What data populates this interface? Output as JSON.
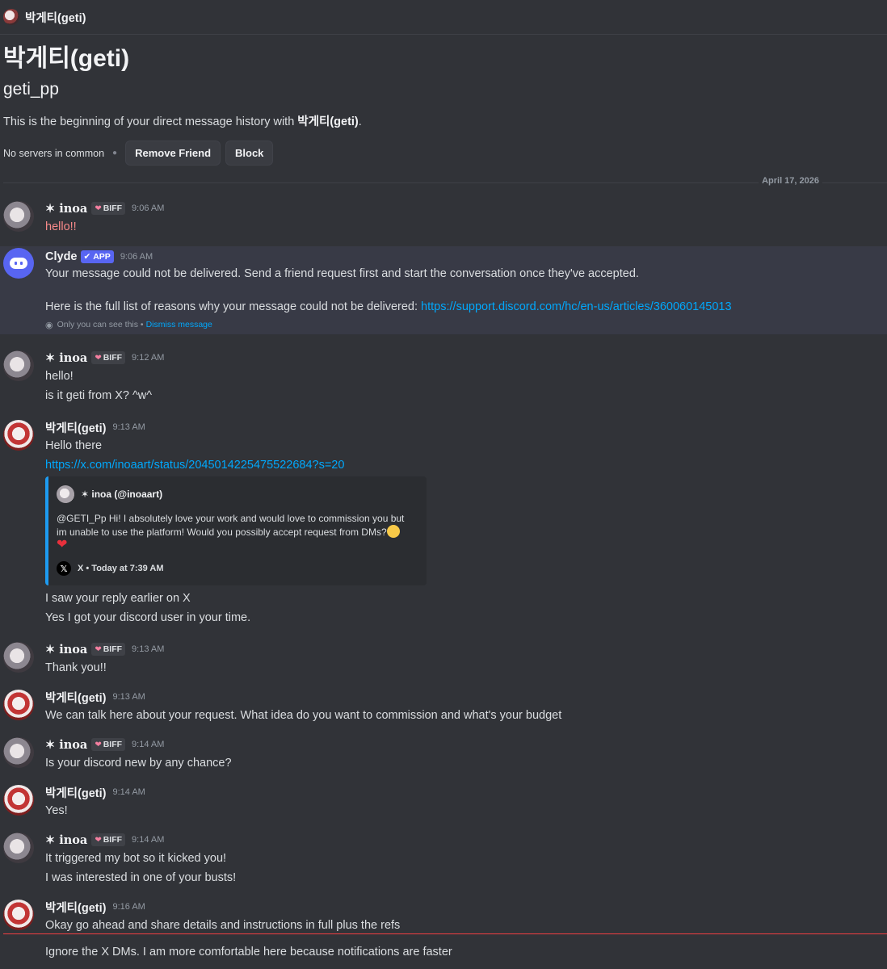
{
  "topbar": {
    "name": "박게티(geti)"
  },
  "intro": {
    "display_name": "박게티(geti)",
    "username": "geti_pp",
    "text_before": "This is the beginning of your direct message history with ",
    "text_name": "박게티(geti)",
    "text_after": ".",
    "servers_common": "No servers in common",
    "remove_friend": "Remove Friend",
    "block": "Block"
  },
  "date_divider": "April 17, 2026",
  "badges": {
    "biff": "BIFF",
    "app": "APP"
  },
  "users": {
    "inoa": "✶ 𝐢𝐧𝐨𝐚",
    "clyde": "Clyde",
    "geti": "박게티(geti)"
  },
  "messages": [
    {
      "time": "9:06 AM",
      "lines": [
        "hello!!"
      ]
    },
    {
      "time": "9:06 AM",
      "lines": [
        "Your message could not be delivered. Send a friend request first and start the conversation once they've accepted.",
        "Here is the full list of reasons why your message could not be delivered: "
      ],
      "link": "https://support.discord.com/hc/en-us/articles/360060145013",
      "ephemeral": "Only you can see this •",
      "dismiss": "Dismiss message"
    },
    {
      "time": "9:12 AM",
      "lines": [
        "hello!",
        "is it geti from X? ^w^"
      ]
    },
    {
      "time": "9:13 AM",
      "lines": [
        "Hello there"
      ],
      "link": "https://x.com/inoaart/status/2045014225475522684?s=20",
      "after": [
        "I saw your reply earlier on X",
        "Yes I got your discord user in your time."
      ]
    },
    {
      "time": "9:13 AM",
      "lines": [
        "Thank you!!"
      ]
    },
    {
      "time": "9:13 AM",
      "lines": [
        "We can talk here about your request. What idea do you want to commission and what's your budget"
      ]
    },
    {
      "time": "9:14 AM",
      "lines": [
        "Is your discord new by any chance?"
      ]
    },
    {
      "time": "9:14 AM",
      "lines": [
        "Yes!"
      ]
    },
    {
      "time": "9:14 AM",
      "lines": [
        "It triggered my bot so it kicked you!",
        "I was interested in one of your busts!"
      ]
    },
    {
      "time": "9:16 AM",
      "lines": [
        "Okay go ahead and share details and instructions in full plus the refs",
        "Ignore the X DMs. I am more comfortable here because notifications are faster"
      ]
    }
  ],
  "embed": {
    "author": "✶ inoa (@inoaart)",
    "description": "@GETI_Pp Hi! I absolutely love your work and would love to commission you but im unable to use the platform! Would you possibly accept request from DMs?",
    "heart": "❤",
    "footer": "X • Today at 7:39 AM",
    "x_glyph": "𝕏",
    "accent_color": "#1d9bf0"
  }
}
